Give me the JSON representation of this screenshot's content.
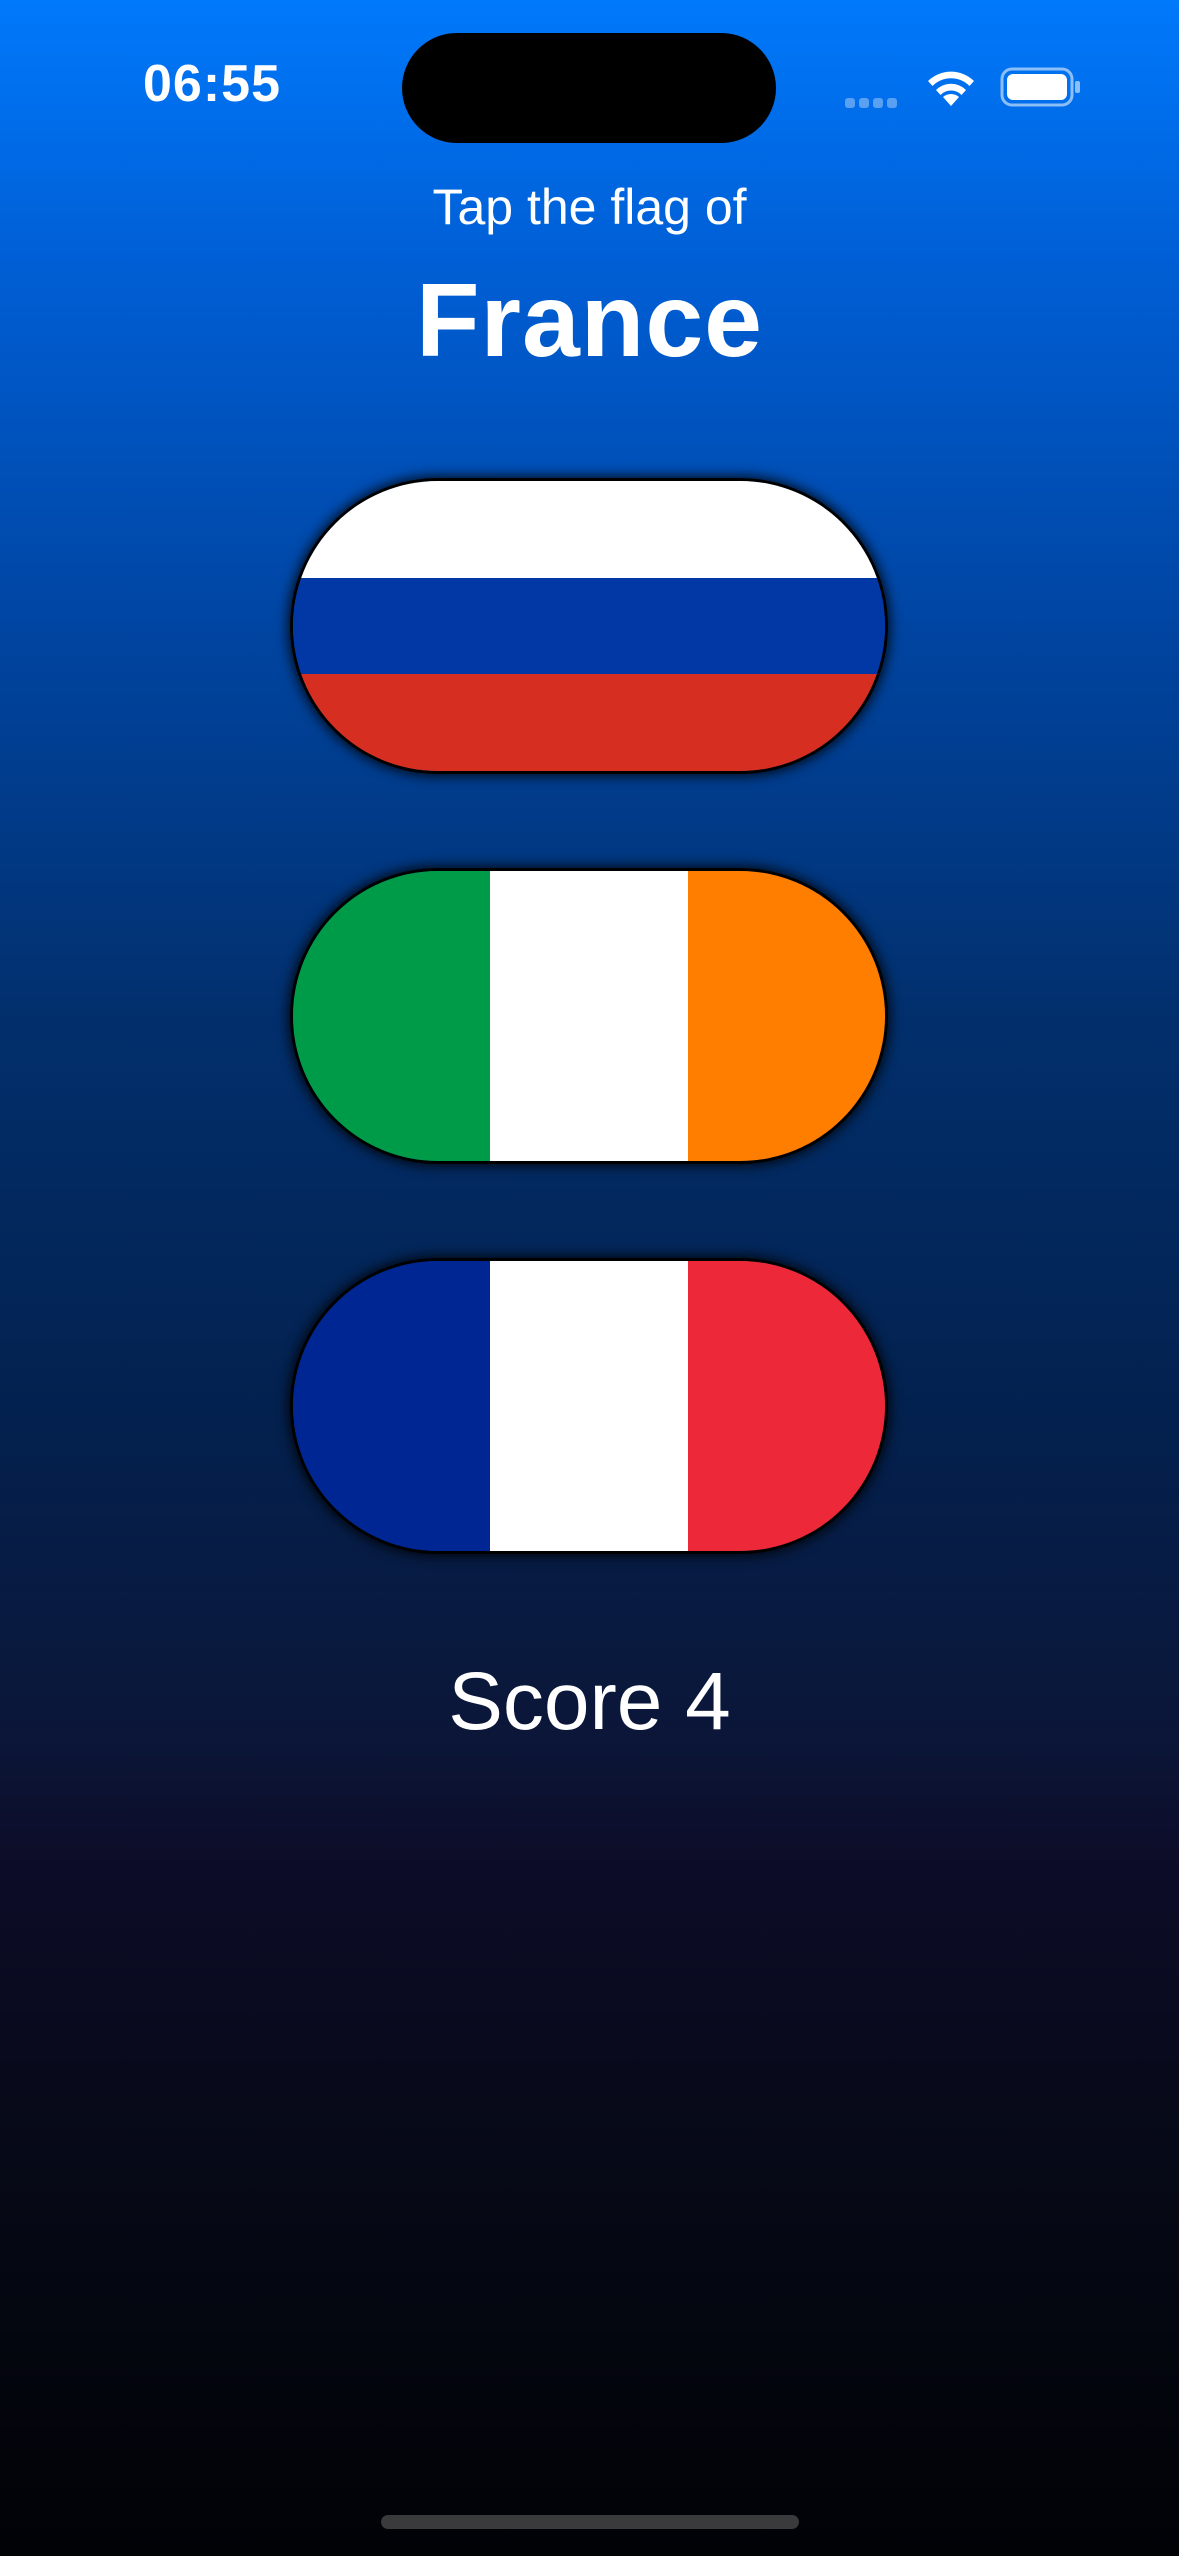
{
  "status_bar": {
    "time": "06:55",
    "signal_icon": "cellular-signal-icon",
    "wifi_icon": "wifi-icon",
    "battery_icon": "battery-icon"
  },
  "game": {
    "prompt": "Tap the flag of",
    "country": "France",
    "score_text": "Score 4"
  },
  "flags": [
    {
      "country": "Russia",
      "layout": "horizontal",
      "colors": [
        "#ffffff",
        "#0238a6",
        "#d62e20"
      ]
    },
    {
      "country": "Ireland",
      "layout": "vertical",
      "colors": [
        "#009b48",
        "#ffffff",
        "#ff7e00"
      ]
    },
    {
      "country": "France",
      "layout": "vertical",
      "colors": [
        "#002694",
        "#ffffff",
        "#ed2939"
      ]
    }
  ],
  "colors": {
    "background_top": "#0079fb",
    "background_bottom": "#010206",
    "text": "#ffffff"
  }
}
